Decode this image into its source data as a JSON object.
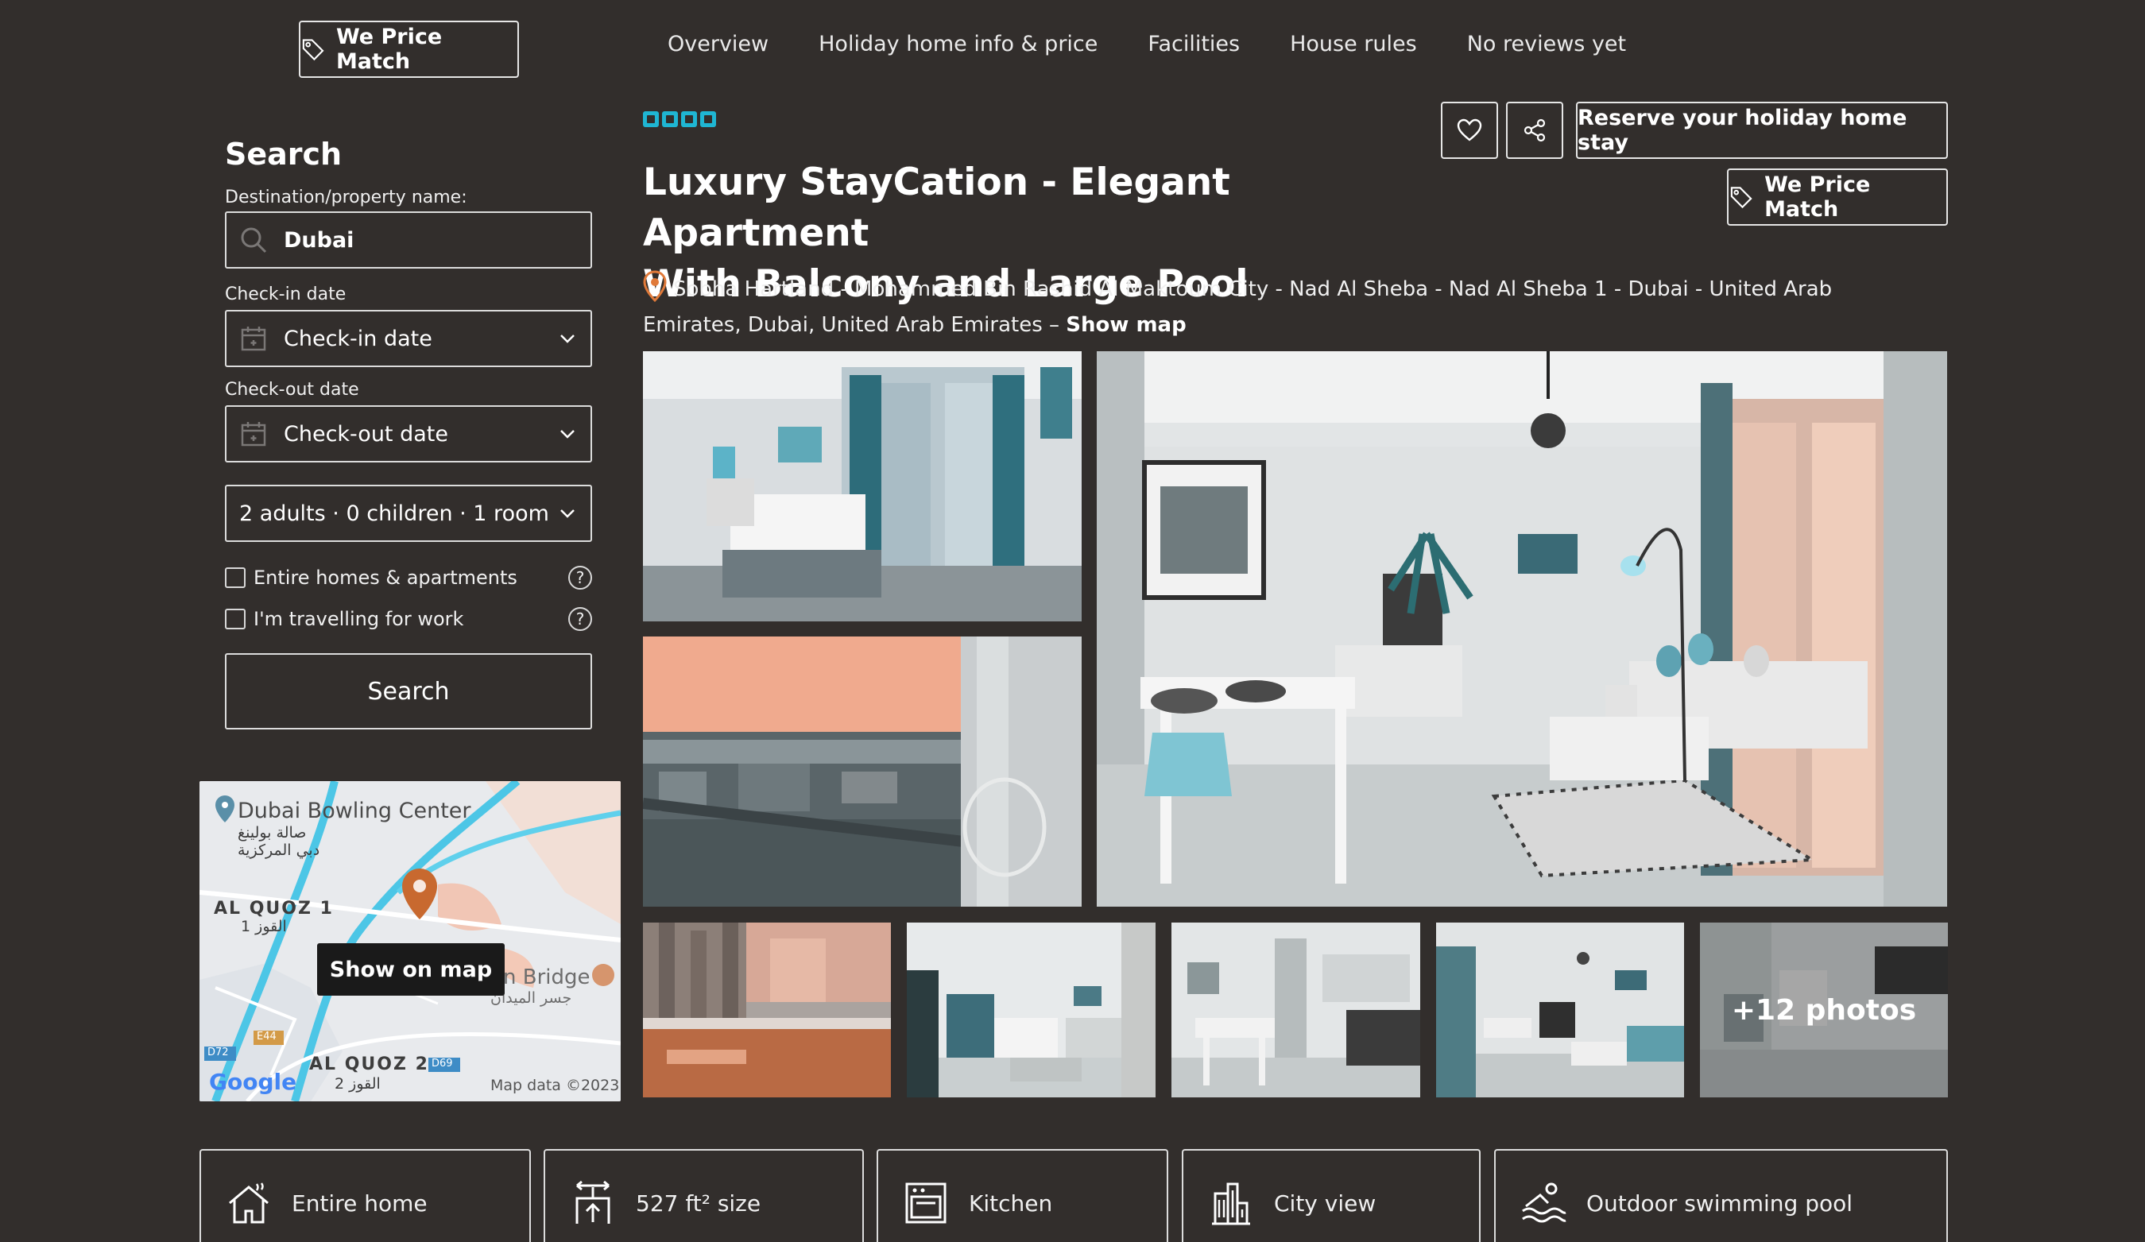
{
  "nav": {
    "price_match": "We Price Match",
    "tabs": [
      "Overview",
      "Holiday home info & price",
      "Facilities",
      "House rules",
      "No reviews yet"
    ]
  },
  "sidebar": {
    "title": "Search",
    "destination": {
      "label": "Destination/property name:",
      "value": "Dubai"
    },
    "checkin": {
      "label": "Check-in date",
      "value": "Check-in date"
    },
    "checkout": {
      "label": "Check-out date",
      "value": "Check-out date"
    },
    "guests": "2 adults · 0 children · 1 room",
    "filters": [
      "Entire homes & apartments",
      "I'm travelling for work"
    ],
    "search_button": "Search"
  },
  "map": {
    "button": "Show on map",
    "labels": {
      "place1": "Dubai Bowling Center",
      "place1_ar1": "صالة بولينغ",
      "place1_ar2": "دبي المركزية",
      "area1": "AL QUOZ 1",
      "area1_ar": "1 القوز",
      "bridge": "n Bridge",
      "bridge_ar": "جسر الميدان",
      "area2": "AL QUOZ 2",
      "area2_ar": "2 القوز",
      "road1": "D72",
      "road2": "E44",
      "road3": "D69",
      "google": "Google",
      "credit": "Map data ©2023"
    }
  },
  "property": {
    "star_count": 4,
    "title_line1": "Luxury StayCation - Elegant Apartment",
    "title_line2": "With Balcony and Large Pool",
    "address": "Sobha Hartland - Mohammed Bin Rashid Al Maktoum City - Nad Al Sheba - Nad Al Sheba 1 - Dubai - United Arab Emirates, Dubai, United Arab Emirates –",
    "show_map": "Show map",
    "reserve_button": "Reserve your holiday home stay",
    "price_match": "We Price Match",
    "more_photos": "+12 photos"
  },
  "amenities": [
    "Entire home",
    "527 ft² size",
    "Kitchen",
    "City view",
    "Outdoor swimming pool"
  ],
  "colors": {
    "background": "#322e2c",
    "accent": "#1fb6d3",
    "pin": "#c8692f"
  }
}
